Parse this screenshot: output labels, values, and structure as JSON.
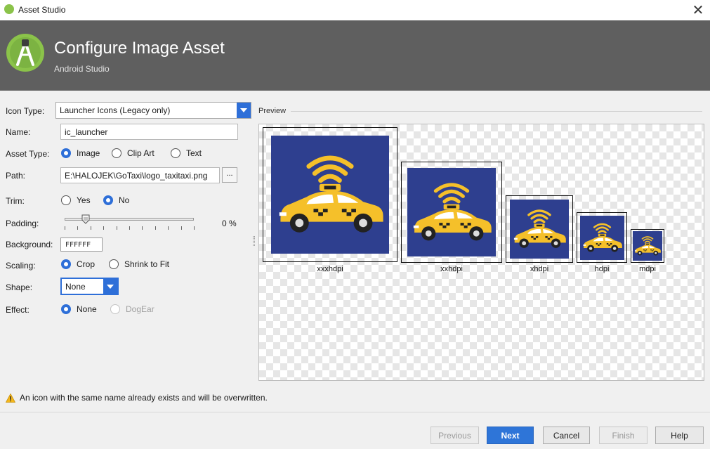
{
  "window": {
    "title": "Asset Studio",
    "close_glyph": "✕"
  },
  "header": {
    "title": "Configure Image Asset",
    "subtitle": "Android Studio"
  },
  "form": {
    "icon_type": {
      "label": "Icon Type:",
      "value": "Launcher Icons (Legacy only)"
    },
    "name": {
      "label": "Name:",
      "value": "ic_launcher"
    },
    "asset_type": {
      "label": "Asset Type:",
      "options": [
        "Image",
        "Clip Art",
        "Text"
      ],
      "selected": "Image"
    },
    "path": {
      "label": "Path:",
      "value": "E:\\HALOJEK\\GoTaxi\\logo_taxitaxi.png",
      "browse_label": "..."
    },
    "trim": {
      "label": "Trim:",
      "options": [
        "Yes",
        "No"
      ],
      "selected": "No"
    },
    "padding": {
      "label": "Padding:",
      "value_text": "0 %",
      "value": 0
    },
    "background": {
      "label": "Background:",
      "value": "FFFFFF"
    },
    "scaling": {
      "label": "Scaling:",
      "options": [
        "Crop",
        "Shrink to Fit"
      ],
      "selected": "Crop"
    },
    "shape": {
      "label": "Shape:",
      "value": "None"
    },
    "effect": {
      "label": "Effect:",
      "options": [
        "None",
        "DogEar"
      ],
      "selected": "None",
      "disabled": [
        "DogEar"
      ]
    }
  },
  "preview": {
    "label": "Preview",
    "densities": [
      "xxxhdpi",
      "xxhdpi",
      "xhdpi",
      "hdpi",
      "mdpi"
    ],
    "icon_bg_color": "#2e3f8f",
    "icon_fg_color": "#f5c02a"
  },
  "warning": {
    "text": "An icon with the same name already exists and will be overwritten.",
    "icon": "warning-icon"
  },
  "buttons": {
    "previous": "Previous",
    "next": "Next",
    "cancel": "Cancel",
    "finish": "Finish",
    "help": "Help"
  },
  "colors": {
    "accent": "#2e6fd8",
    "header_bg": "#5f5f5f",
    "android_green": "#8bc34a"
  }
}
